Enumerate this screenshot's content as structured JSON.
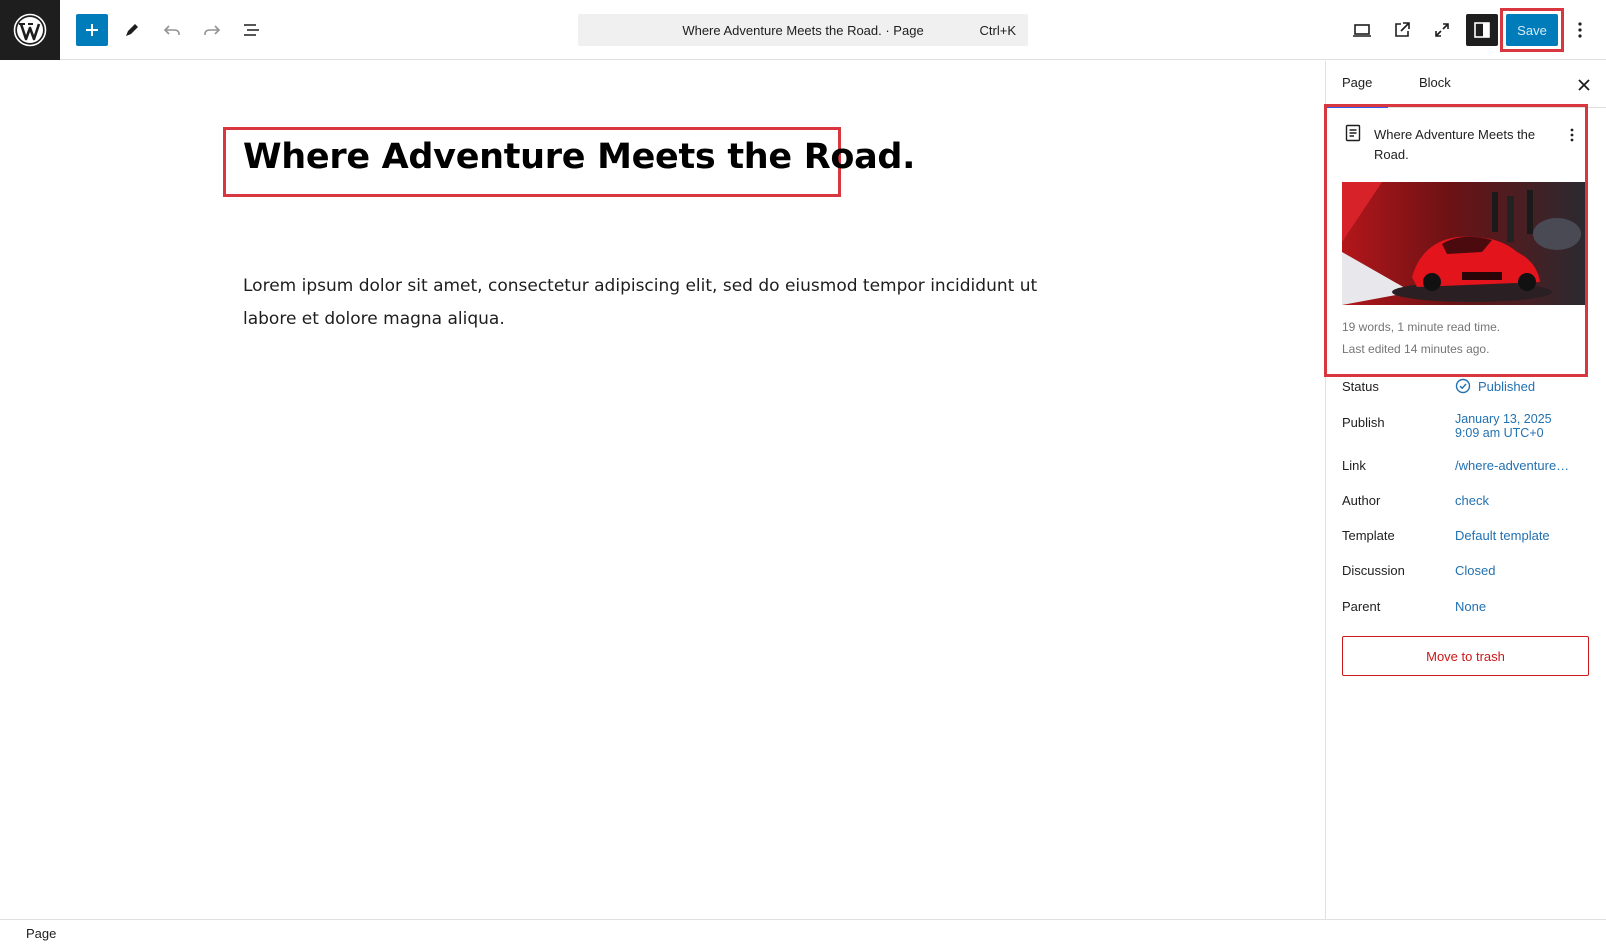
{
  "toolbar": {
    "command_title": "Where Adventure Meets the Road. · Page",
    "command_shortcut": "Ctrl+K",
    "save_label": "Save"
  },
  "editor": {
    "title": "Where Adventure Meets the Road.",
    "paragraph": "Lorem ipsum dolor sit amet, consectetur adipiscing elit, sed do eiusmod tempor incididunt ut labore et dolore magna aliqua."
  },
  "sidebar": {
    "tabs": [
      {
        "label": "Page"
      },
      {
        "label": "Block"
      }
    ],
    "post_title": "Where Adventure Meets the Road.",
    "meta_words": "19 words, 1 minute read time.",
    "meta_edited": "Last edited 14 minutes ago.",
    "rows": [
      {
        "label": "Status",
        "value": "Published"
      },
      {
        "label": "Publish",
        "value": "January 13, 2025",
        "value2": "9:09 am UTC+0"
      },
      {
        "label": "Link",
        "value": "/where-adventure…"
      },
      {
        "label": "Author",
        "value": "check"
      },
      {
        "label": "Template",
        "value": "Default template"
      },
      {
        "label": "Discussion",
        "value": "Closed"
      },
      {
        "label": "Parent",
        "value": "None"
      }
    ],
    "trash_label": "Move to trash"
  },
  "footer": {
    "breadcrumb": "Page"
  },
  "colors": {
    "accent": "#007cba",
    "highlight": "#d9373f",
    "danger": "#cc1818",
    "link": "#2271b1"
  },
  "icons": [
    "wordpress-logo-icon",
    "plus-icon",
    "pencil-icon",
    "undo-icon",
    "redo-icon",
    "document-overview-icon",
    "desktop-view-icon",
    "external-link-icon",
    "fullscreen-icon",
    "sidebar-settings-icon",
    "more-vertical-icon",
    "close-icon",
    "page-icon",
    "check-circle-icon"
  ]
}
